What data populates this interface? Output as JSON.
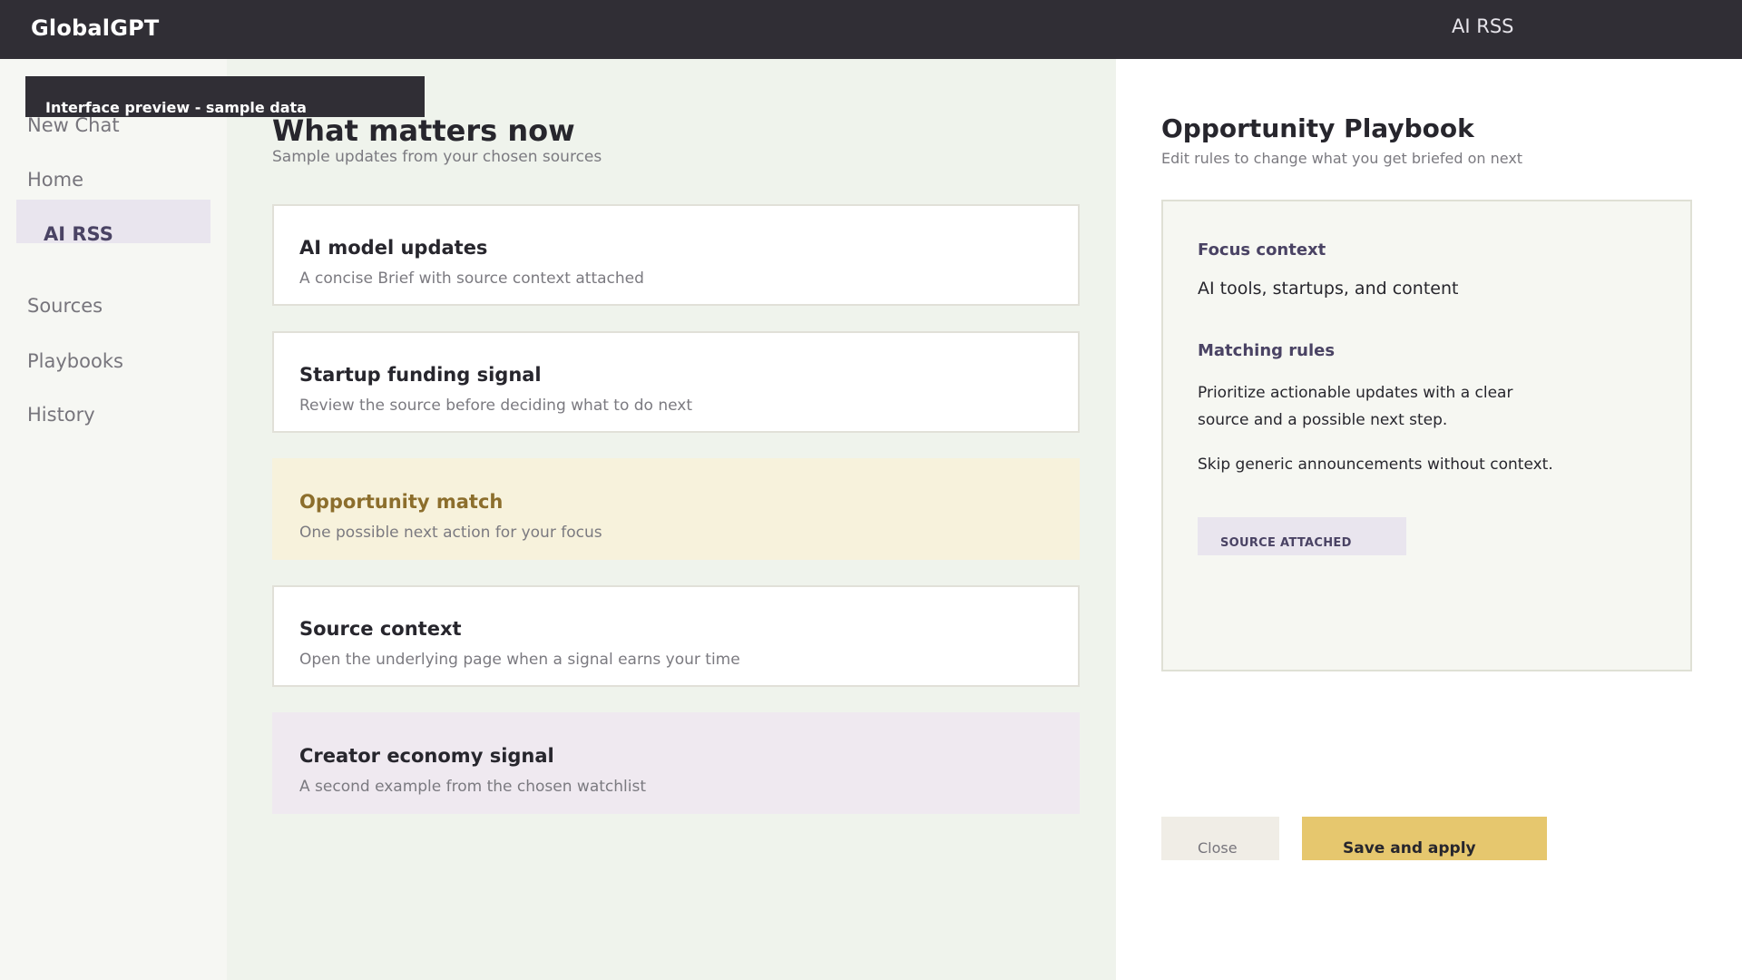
{
  "topbar": {
    "brand": "GlobalGPT",
    "section": "AI RSS"
  },
  "banner": {
    "text": "Interface preview - sample data"
  },
  "sidebar": {
    "items": [
      {
        "label": "New Chat"
      },
      {
        "label": "Home"
      },
      {
        "label": "AI RSS",
        "active": true
      },
      {
        "label": "Sources"
      },
      {
        "label": "Playbooks"
      },
      {
        "label": "History"
      }
    ]
  },
  "main": {
    "title": "What matters now",
    "subtitle": "Sample updates from your chosen sources",
    "cards": [
      {
        "title": "AI model updates",
        "subtitle": "A concise Brief with source context attached"
      },
      {
        "title": "Startup funding signal",
        "subtitle": "Review the source before deciding what to do next"
      },
      {
        "title": "Opportunity match",
        "subtitle": "One possible next action for your focus"
      },
      {
        "title": "Source context",
        "subtitle": "Open the underlying page when a signal earns your time"
      },
      {
        "title": "Creator economy signal",
        "subtitle": "A second example from the chosen watchlist"
      }
    ]
  },
  "panel": {
    "title": "Opportunity Playbook",
    "subtitle": "Edit rules to change what you get briefed on next",
    "focus_label": "Focus context",
    "focus_value": "AI tools, startups, and content",
    "rules_label": "Matching rules",
    "rules": [
      "Prioritize actionable updates with a clear source and a possible next step.",
      "Skip generic announcements without context."
    ],
    "badge": "SOURCE ATTACHED",
    "close_label": "Close",
    "save_label": "Save and apply"
  },
  "colors": {
    "topbar": "#302e35",
    "accent_gold": "#e6c76e",
    "accent_purple": "#4a4364",
    "highlight_card": "#f7f2dc",
    "lavender_card": "#efe9f0"
  }
}
